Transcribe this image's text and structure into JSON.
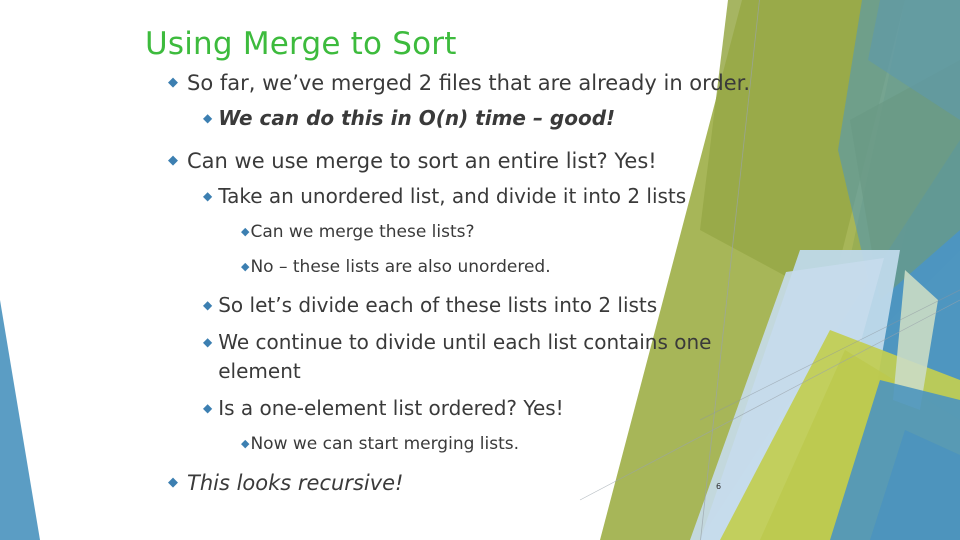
{
  "slide": {
    "title": "Using Merge to Sort",
    "number": "6",
    "title_color": "#3DBB3D",
    "bullet_color": "#3C7FB1",
    "text_color": "#3A3A3A",
    "background_color": "#FFFFFF",
    "accent_olive": "#9FB04A",
    "accent_teal": "#4D95BF",
    "accent_pale_blue": "#BFD9EA"
  },
  "bullets": [
    {
      "level": 1,
      "style": "normal",
      "text": "So far, we’ve merged 2 files that are already in order."
    },
    {
      "level": 2,
      "style": "bold-italic",
      "text": "We can do this in O(n) time – good!"
    },
    {
      "level": 1,
      "style": "normal",
      "text": "Can we use merge to sort an entire list?   Yes!"
    },
    {
      "level": 2,
      "style": "normal",
      "text": "Take an unordered list, and divide it into 2 lists"
    },
    {
      "level": 3,
      "style": "normal",
      "text": "Can we merge these lists?"
    },
    {
      "level": 3,
      "style": "normal",
      "text": "No – these lists are also unordered."
    },
    {
      "level": 2,
      "style": "normal",
      "text": "So let’s divide each of these lists into 2 lists"
    },
    {
      "level": 2,
      "style": "normal",
      "text": "We continue to divide until each list contains one element"
    },
    {
      "level": 2,
      "style": "normal",
      "text": "Is a one-element list ordered?  Yes!"
    },
    {
      "level": 3,
      "style": "normal",
      "text": "Now we can start merging lists."
    },
    {
      "level": 1,
      "style": "italic",
      "text": "This looks recursive!"
    }
  ],
  "icons": {
    "bullet_glyph": "◆",
    "bullet_name": "diamond-bullet-icon"
  }
}
